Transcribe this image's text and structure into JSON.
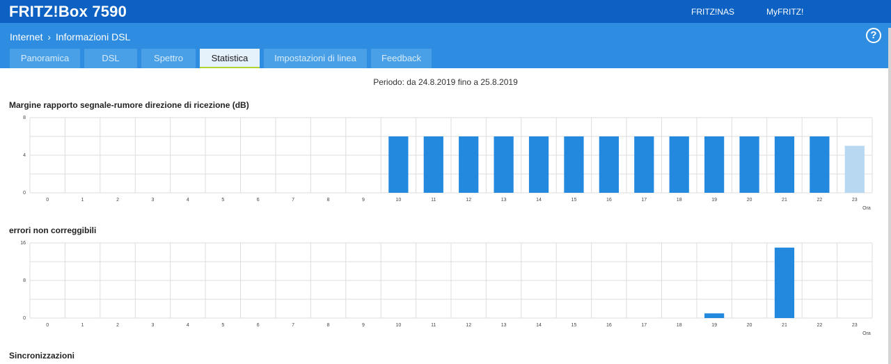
{
  "header": {
    "brand": "FRITZ!Box 7590",
    "links": [
      "FRITZ!NAS",
      "MyFRITZ!"
    ]
  },
  "breadcrumb": {
    "parent": "Internet",
    "separator": "›",
    "current": "Informazioni DSL",
    "help": "?"
  },
  "tabs": [
    {
      "label": "Panoramica",
      "active": false
    },
    {
      "label": "DSL",
      "active": false
    },
    {
      "label": "Spettro",
      "active": false
    },
    {
      "label": "Statistica",
      "active": true
    },
    {
      "label": "Impostazioni di linea",
      "active": false
    },
    {
      "label": "Feedback",
      "active": false
    }
  ],
  "period": "Periodo: da 24.8.2019 fino a 25.8.2019",
  "sections": {
    "snr_title": "Margine rapporto segnale-rumore direzione di ricezione (dB)",
    "errors_title": "errori non correggibili",
    "sync_title": "Sincronizzazioni"
  },
  "colors": {
    "bar": "#2289df",
    "bar_current": "#b8d8f2",
    "grid": "#dddddd"
  },
  "chart_data": [
    {
      "type": "bar",
      "title": "Margine rapporto segnale-rumore direzione di ricezione (dB)",
      "xlabel": "Ora",
      "categories": [
        "0",
        "1",
        "2",
        "3",
        "4",
        "5",
        "6",
        "7",
        "8",
        "9",
        "10",
        "11",
        "12",
        "13",
        "14",
        "15",
        "16",
        "17",
        "18",
        "19",
        "20",
        "21",
        "22",
        "23"
      ],
      "values": [
        null,
        null,
        null,
        null,
        null,
        null,
        null,
        null,
        null,
        null,
        6,
        6,
        6,
        6,
        6,
        6,
        6,
        6,
        6,
        6,
        6,
        6,
        6,
        5
      ],
      "current_hour_index": 23,
      "yticks": [
        0,
        4,
        8
      ],
      "ylim": [
        0,
        8
      ],
      "grid": true
    },
    {
      "type": "bar",
      "title": "errori non correggibili",
      "xlabel": "Ora",
      "categories": [
        "0",
        "1",
        "2",
        "3",
        "4",
        "5",
        "6",
        "7",
        "8",
        "9",
        "10",
        "11",
        "12",
        "13",
        "14",
        "15",
        "16",
        "17",
        "18",
        "19",
        "20",
        "21",
        "22",
        "23"
      ],
      "values": [
        0,
        0,
        0,
        0,
        0,
        0,
        0,
        0,
        0,
        0,
        0,
        0,
        0,
        0,
        0,
        0,
        0,
        0,
        0,
        1,
        0,
        15,
        0,
        0
      ],
      "yticks": [
        0,
        8,
        16
      ],
      "ylim": [
        0,
        16
      ],
      "grid": true
    }
  ]
}
